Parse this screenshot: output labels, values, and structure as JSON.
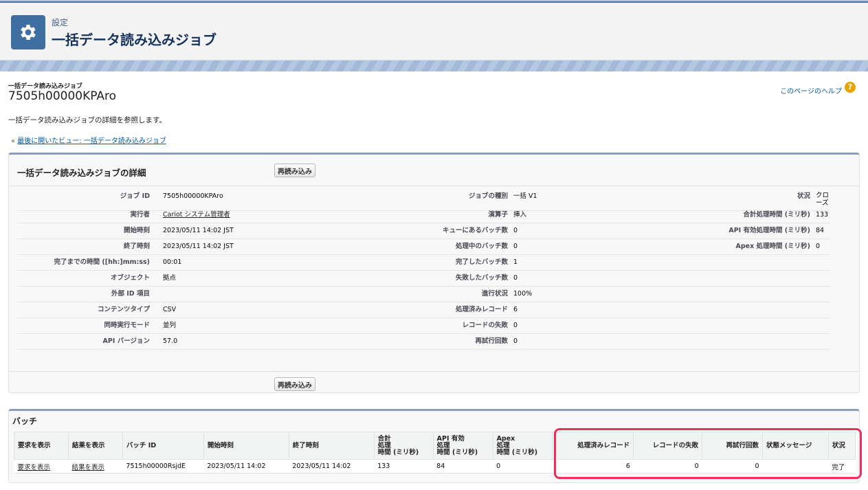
{
  "header": {
    "setup_label": "設定",
    "title": "一括データ読み込みジョブ",
    "icon": "gear-icon"
  },
  "page": {
    "object_type": "一括データ読み込みジョブ",
    "record_id": "7505h00000KPAro",
    "help_link": "このページのヘルプ",
    "description": "一括データ読み込みジョブの詳細を参照します。",
    "back_prefix": "« ",
    "back_link": "最後に開いたビュー: 一括データ読み込みジョブ"
  },
  "detail": {
    "title": "一括データ読み込みジョブの詳細",
    "reload_label": "再読み込み",
    "rows": [
      {
        "l1": "ジョブ ID",
        "v1": "7505h00000KPAro",
        "l2": "ジョブの種別",
        "v2": "一括 V1",
        "l3": "状況",
        "v3": "クローズ"
      },
      {
        "l1": "実行者",
        "v1": "Cariot システム管理者",
        "l2": "演算子",
        "v2": "挿入",
        "l3": "合計処理時間 (ミリ秒)",
        "v3": "133"
      },
      {
        "l1": "開始時刻",
        "v1": "2023/05/11 14:02 JST",
        "l2": "キューにあるバッチ数",
        "v2": "0",
        "l3": "API 有効処理時間 (ミリ秒)",
        "v3": "84"
      },
      {
        "l1": "終了時刻",
        "v1": "2023/05/11 14:02 JST",
        "l2": "処理中のバッチ数",
        "v2": "0",
        "l3": "Apex 処理時間 (ミリ秒)",
        "v3": "0"
      },
      {
        "l1": "完了までの時間 ([hh:]mm:ss)",
        "v1": "00:01",
        "l2": "完了したバッチ数",
        "v2": "1",
        "l3": "",
        "v3": ""
      },
      {
        "l1": "オブジェクト",
        "v1": "拠点",
        "l2": "失敗したバッチ数",
        "v2": "0",
        "l3": "",
        "v3": ""
      },
      {
        "l1": "外部 ID 項目",
        "v1": "",
        "l2": "進行状況",
        "v2": "100%",
        "l3": "",
        "v3": ""
      },
      {
        "l1": "コンテンツタイプ",
        "v1": "CSV",
        "l2": "処理済みレコード",
        "v2": "6",
        "l3": "",
        "v3": ""
      },
      {
        "l1": "同時実行モード",
        "v1": "並列",
        "l2": "レコードの失敗",
        "v2": "0",
        "l3": "",
        "v3": ""
      },
      {
        "l1": "API バージョン",
        "v1": "57.0",
        "l2": "再試行回数",
        "v2": "0",
        "l3": "",
        "v3": ""
      }
    ]
  },
  "batches": {
    "title": "バッチ",
    "columns": [
      "要求を表示",
      "結果を表示",
      "バッチ ID",
      "開始時刻",
      "終了時刻",
      "合計\n処理\n時間 (ミリ秒)",
      "API 有効\n処理\n時間 (ミリ秒)",
      "Apex\n処理\n時間 (ミリ秒)",
      "処理済みレコード",
      "レコードの失敗",
      "再試行回数",
      "状態メッセージ",
      "状況"
    ],
    "rows": [
      [
        "要求を表示",
        "結果を表示",
        "7515h00000RsjdE",
        "2023/05/11 14:02",
        "2023/05/11 14:02",
        "133",
        "84",
        "0",
        "6",
        "0",
        "0",
        "",
        "完了"
      ]
    ]
  },
  "colors": {
    "accent": "#3f6ea3",
    "highlight": "#e8305a",
    "link": "#015ba7"
  }
}
